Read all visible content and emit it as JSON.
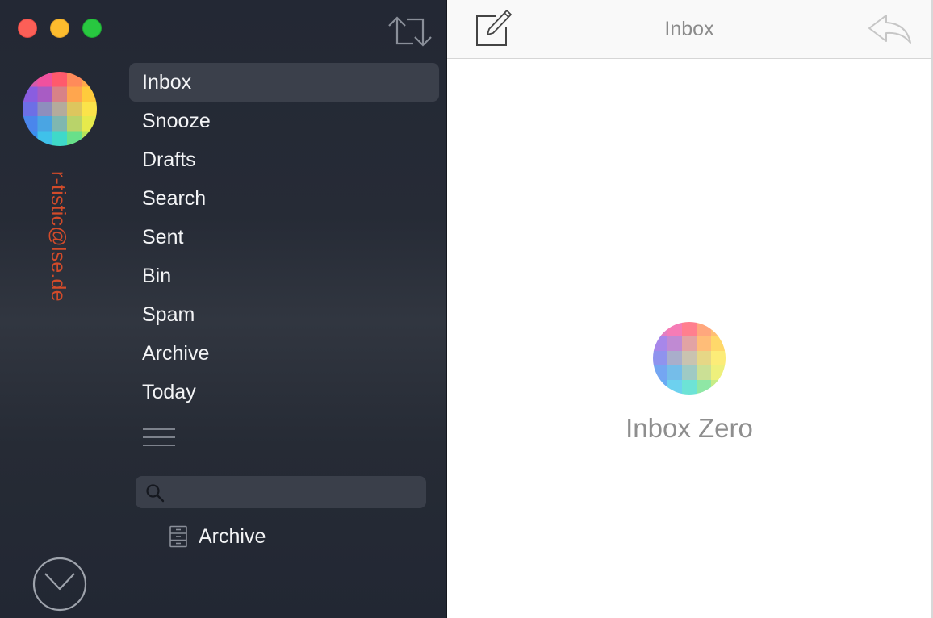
{
  "window": {
    "controls": [
      "close",
      "minimize",
      "zoom"
    ]
  },
  "sidebar": {
    "sync_icon": "sync-arrows-icon",
    "account": {
      "email": "r-tistic@lse.de",
      "avatar_icon": "pixel-color-avatar"
    },
    "items": [
      {
        "label": "Inbox",
        "active": true
      },
      {
        "label": "Snooze"
      },
      {
        "label": "Drafts"
      },
      {
        "label": "Search"
      },
      {
        "label": "Sent"
      },
      {
        "label": "Bin"
      },
      {
        "label": "Spam"
      },
      {
        "label": "Archive"
      },
      {
        "label": "Today"
      }
    ],
    "more_icon": "hamburger-menu-icon",
    "search": {
      "placeholder": "",
      "value": ""
    },
    "folders": [
      {
        "label": "Archive",
        "icon": "file-cabinet-icon"
      }
    ],
    "bottom_icon": "mail-app-icon"
  },
  "main": {
    "toolbar": {
      "title": "Inbox",
      "compose_icon": "compose-icon",
      "reply_icon": "reply-icon"
    },
    "empty_state": {
      "text": "Inbox Zero",
      "icon": "pixel-color-logo"
    }
  },
  "colors": {
    "sidebar_bg": "#262b36",
    "active_item_bg": "#3b404b",
    "email_accent": "#d24b2a",
    "toolbar_bg": "#f9f9f9",
    "muted_text": "#8e8e8e"
  }
}
